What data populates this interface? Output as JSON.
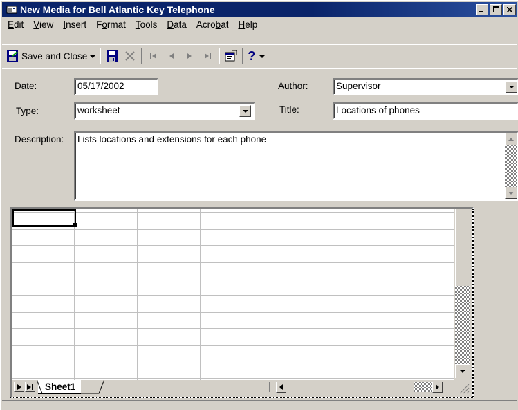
{
  "window": {
    "title": "New Media for Bell Atlantic Key Telephone"
  },
  "menu": [
    {
      "label": "Edit",
      "underline": "E",
      "rest": "dit"
    },
    {
      "label": "View",
      "underline": "V",
      "rest": "iew"
    },
    {
      "label": "Insert",
      "underline": "I",
      "rest": "nsert"
    },
    {
      "label": "Format",
      "pre": "F",
      "underline": "o",
      "rest": "rmat"
    },
    {
      "label": "Tools",
      "underline": "T",
      "rest": "ools"
    },
    {
      "label": "Data",
      "underline": "D",
      "rest": "ata"
    },
    {
      "label": "Acrobat",
      "pre": "Acro",
      "underline": "b",
      "rest": "at"
    },
    {
      "label": "Help",
      "underline": "H",
      "rest": "elp"
    }
  ],
  "toolbar": {
    "save_close_label": "Save and Close",
    "help_icon": "?"
  },
  "form": {
    "date_label": "Date:",
    "date_value": "05/17/2002",
    "author_label": "Author:",
    "author_value": "Supervisor",
    "type_label": "Type:",
    "type_value": "worksheet",
    "title_label": "Title:",
    "title_value": "Locations of phones",
    "description_label": "Description:",
    "description_value": "Lists locations and extensions for each phone"
  },
  "sheet": {
    "tab_label": "Sheet1"
  },
  "colors": {
    "titlebar": "#0a246a",
    "face": "#d4d0c8"
  }
}
